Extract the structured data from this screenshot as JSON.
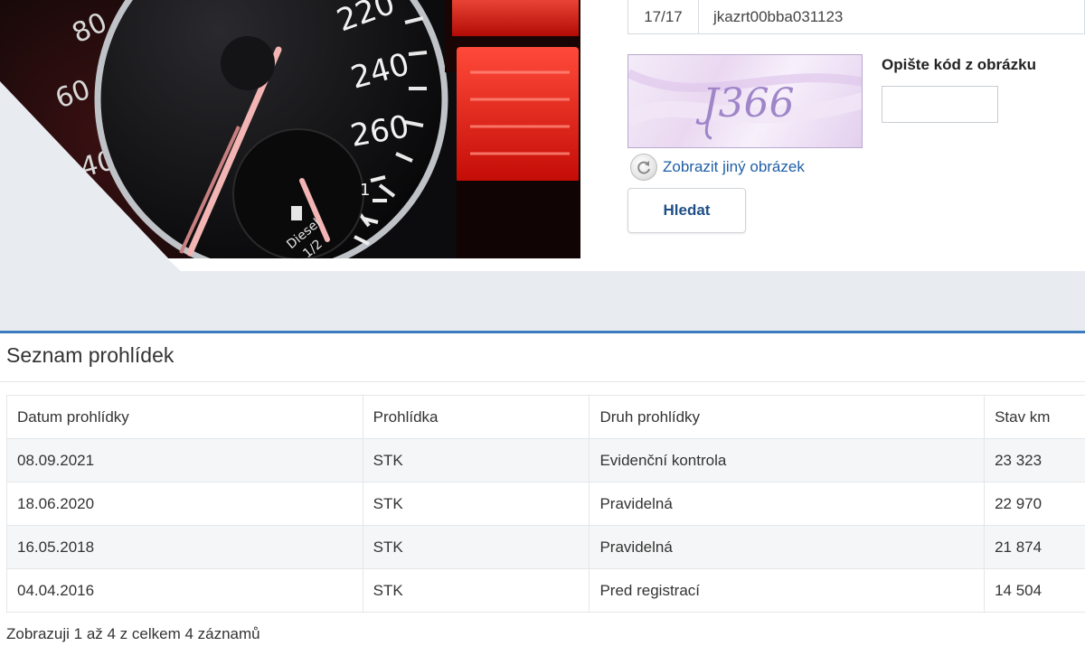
{
  "vin_row": {
    "count": "17/17",
    "value": "jkazrt00bba031123"
  },
  "captcha": {
    "image_text": "J366",
    "label": "Opište kód z obrázku",
    "input_value": "",
    "refresh_label": "Zobrazit jiný obrázek"
  },
  "search_button_label": "Hledat",
  "hero": {
    "speed_labels": [
      "220",
      "240",
      "260"
    ],
    "left_labels": [
      "80",
      "60",
      "40"
    ],
    "fuel_label": "Diesel",
    "fuel_fraction": "1/2",
    "fuel_full": "1"
  },
  "inspections": {
    "title": "Seznam prohlídek",
    "headers": {
      "date": "Datum prohlídky",
      "type": "Prohlídka",
      "kind": "Druh prohlídky",
      "km": "Stav km"
    },
    "rows": [
      {
        "date": "08.09.2021",
        "type": "STK",
        "kind": "Evidenční kontrola",
        "km": "23 323"
      },
      {
        "date": "18.06.2020",
        "type": "STK",
        "kind": "Pravidelná",
        "km": "22 970"
      },
      {
        "date": "16.05.2018",
        "type": "STK",
        "kind": "Pravidelná",
        "km": "21 874"
      },
      {
        "date": "04.04.2016",
        "type": "STK",
        "kind": "Pred registrací",
        "km": "14 504"
      }
    ],
    "info": "Zobrazuji 1 až 4 z celkem 4 záznamů"
  },
  "colors": {
    "accent_border": "#3b7bbf",
    "link": "#1f5fa6",
    "button_text": "#1f4f86",
    "band": "#e8ecf1",
    "dashboard_red": "#ff2a1a"
  }
}
